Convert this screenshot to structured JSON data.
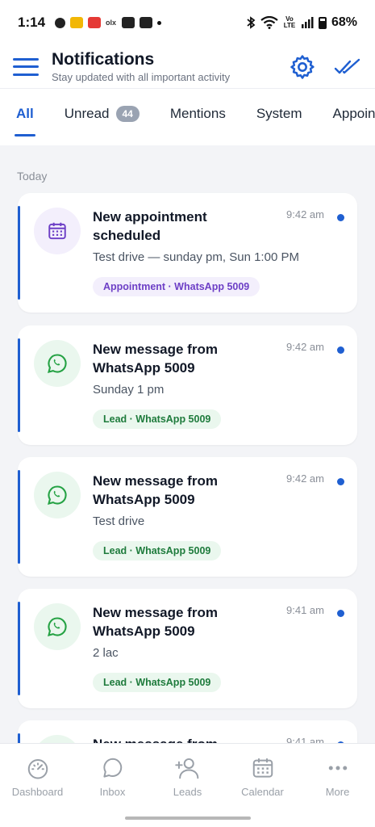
{
  "status_bar": {
    "time": "1:14",
    "battery": "68%",
    "volte": "Vo LTE"
  },
  "header": {
    "title": "Notifications",
    "subtitle": "Stay updated with all important activity"
  },
  "tabs": [
    {
      "label": "All",
      "active": true
    },
    {
      "label": "Unread",
      "count": "44"
    },
    {
      "label": "Mentions"
    },
    {
      "label": "System"
    },
    {
      "label": "Appointments"
    }
  ],
  "section": {
    "label": "Today"
  },
  "notifications": [
    {
      "title": "New appointment scheduled",
      "time": "9:42 am",
      "body": "Test drive — sunday pm, Sun 1:00 PM",
      "chip": "Appointment · WhatsApp 5009",
      "icon": "calendar-icon",
      "kind": "appointment"
    },
    {
      "title": "New message from WhatsApp 5009",
      "time": "9:42 am",
      "body": "Sunday 1 pm",
      "chip": "Lead · WhatsApp 5009",
      "icon": "whatsapp-icon",
      "kind": "lead"
    },
    {
      "title": "New message from WhatsApp 5009",
      "time": "9:42 am",
      "body": "Test drive",
      "chip": "Lead · WhatsApp 5009",
      "icon": "whatsapp-icon",
      "kind": "lead"
    },
    {
      "title": "New message from WhatsApp 5009",
      "time": "9:41 am",
      "body": "2 lac",
      "chip": "Lead · WhatsApp 5009",
      "icon": "whatsapp-icon",
      "kind": "lead"
    },
    {
      "title": "New message from",
      "time": "9:41 am",
      "icon": "whatsapp-icon",
      "kind": "lead"
    }
  ],
  "bottom_nav": [
    {
      "label": "Dashboard",
      "icon": "gauge-icon"
    },
    {
      "label": "Inbox",
      "icon": "chat-bubble-icon"
    },
    {
      "label": "Leads",
      "icon": "add-user-icon"
    },
    {
      "label": "Calendar",
      "icon": "calendar-icon"
    },
    {
      "label": "More",
      "icon": "more-dots-icon"
    }
  ],
  "colors": {
    "accent": "#1f5fd1",
    "purple": "#6d3fc6",
    "green": "#1e7b3c",
    "whatsapp": "#25a244"
  }
}
